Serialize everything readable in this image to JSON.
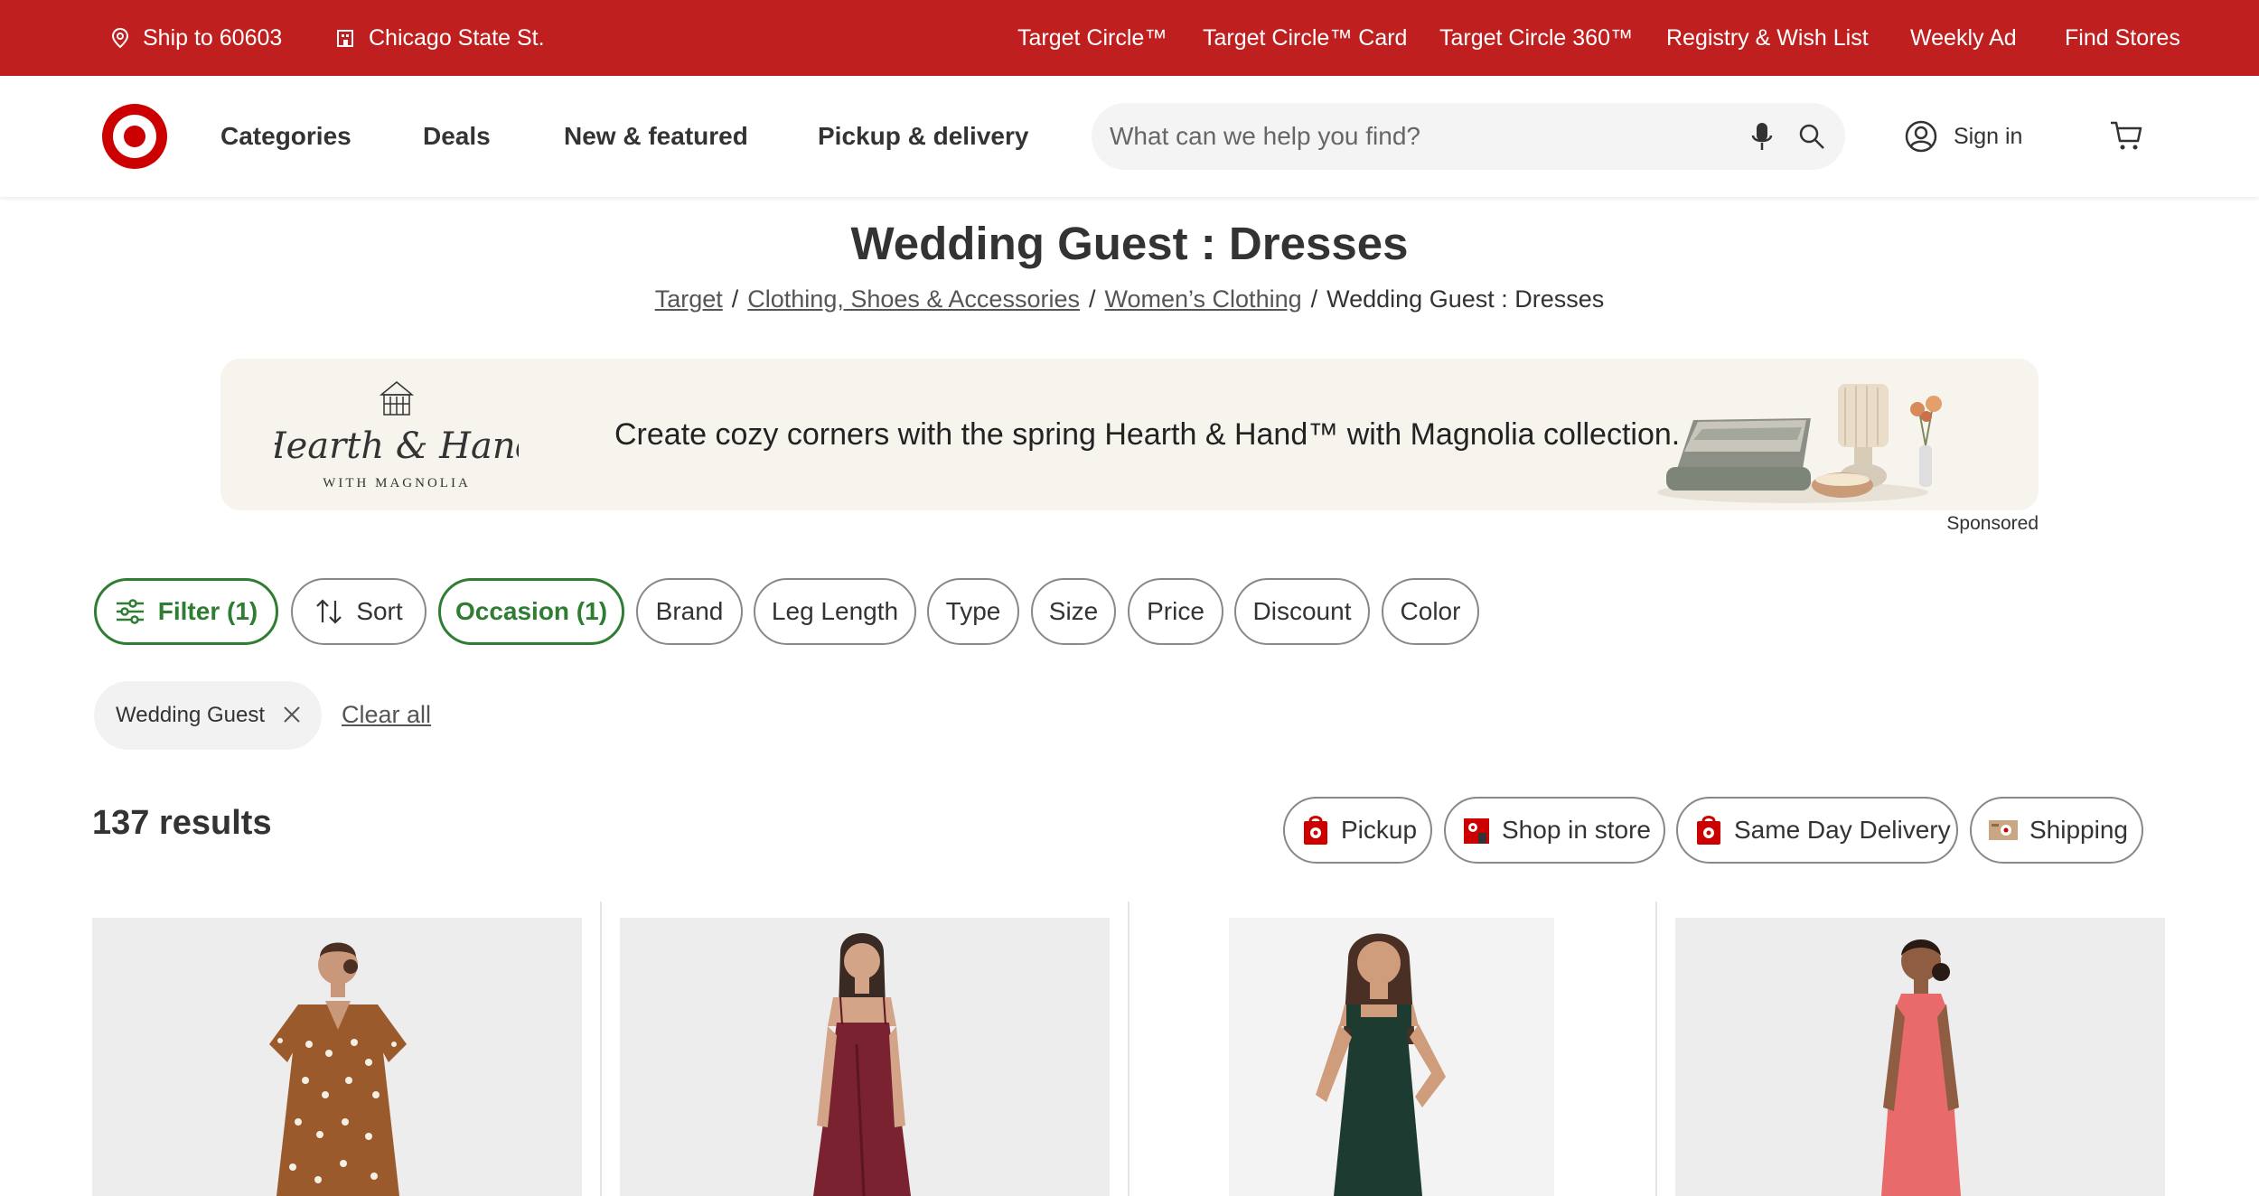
{
  "utility": {
    "ship_to": "Ship to 60603",
    "store": "Chicago State St.",
    "links": [
      "Target Circle™",
      "Target Circle™ Card",
      "Target Circle 360™",
      "Registry & Wish List",
      "Weekly Ad",
      "Find Stores"
    ]
  },
  "header": {
    "nav": [
      "Categories",
      "Deals",
      "New & featured",
      "Pickup & delivery"
    ],
    "search_placeholder": "What can we help you find?",
    "sign_in": "Sign in"
  },
  "page": {
    "title": "Wedding Guest : Dresses",
    "breadcrumb": [
      "Target",
      "Clothing, Shoes & Accessories",
      "Women’s Clothing",
      "Wedding Guest : Dresses"
    ]
  },
  "banner": {
    "brand": "Hearth & Hand",
    "brand_sub": "WITH MAGNOLIA",
    "text": "Create cozy corners with the spring Hearth & Hand™ with Magnolia collection.",
    "sponsored": "Sponsored"
  },
  "filters": {
    "chips": [
      "Filter (1)",
      "Sort",
      "Occasion (1)",
      "Brand",
      "Leg Length",
      "Type",
      "Size",
      "Price",
      "Discount",
      "Color"
    ],
    "applied": "Wedding Guest",
    "clear_all": "Clear all"
  },
  "results": {
    "count": "137 results",
    "fulfillment": [
      "Pickup",
      "Shop in store",
      "Same Day Delivery",
      "Shipping"
    ]
  },
  "colors": {
    "brand_red": "#c01f1f",
    "active_green": "#2e7d32"
  },
  "products": [
    {
      "dress_color": "#9a5a2c",
      "pattern": "polka-dot"
    },
    {
      "dress_color": "#7a2230",
      "pattern": "satin"
    },
    {
      "dress_color": "#1e3b31",
      "pattern": "solid"
    },
    {
      "dress_color": "#e86a6a",
      "pattern": "solid"
    }
  ]
}
